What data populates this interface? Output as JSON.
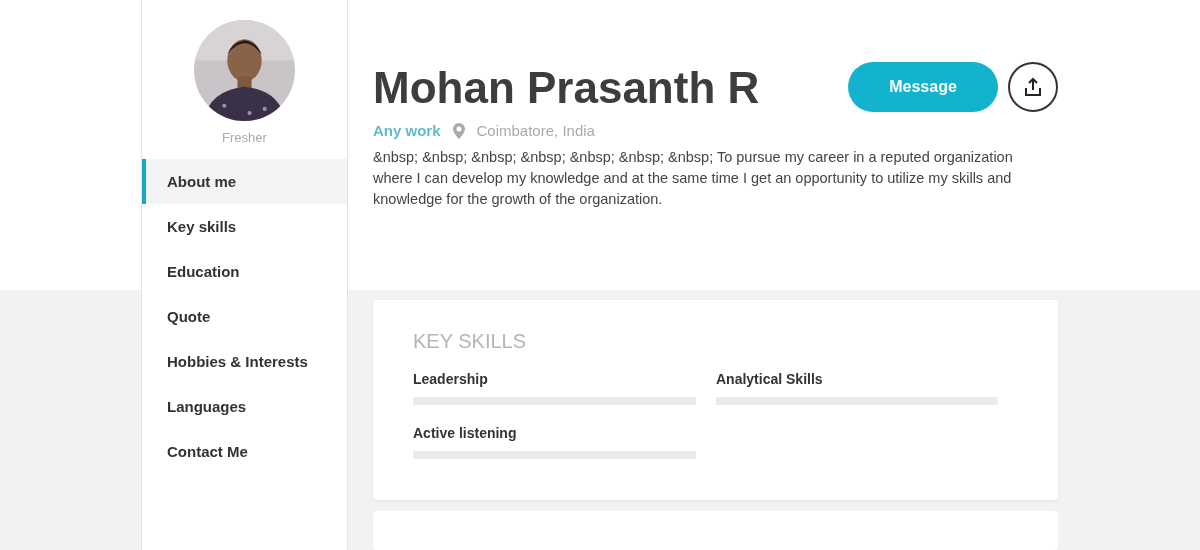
{
  "profile": {
    "status": "Fresher",
    "name": "Mohan Prasanth R",
    "job_type": "Any work",
    "location": "Coimbatore, India",
    "summary": "&nbsp; &nbsp; &nbsp; &nbsp; &nbsp; &nbsp; &nbsp; To pursue my career in a reputed organization where I can develop my knowledge and at the same time I get an opportunity to utilize my skills and knowledge for the growth of the organization.",
    "message_button": "Message"
  },
  "sidebar": {
    "items": [
      {
        "label": "About me",
        "selected": true
      },
      {
        "label": "Key skills",
        "selected": false
      },
      {
        "label": "Education",
        "selected": false
      },
      {
        "label": "Quote",
        "selected": false
      },
      {
        "label": "Hobbies & Interests",
        "selected": false
      },
      {
        "label": "Languages",
        "selected": false
      },
      {
        "label": "Contact Me",
        "selected": false
      }
    ]
  },
  "key_skills": {
    "title": "KEY SKILLS",
    "skills": [
      {
        "name": "Leadership",
        "level": 0
      },
      {
        "name": "Analytical Skills",
        "level": 0
      },
      {
        "name": "Active listening",
        "level": 0
      }
    ]
  }
}
